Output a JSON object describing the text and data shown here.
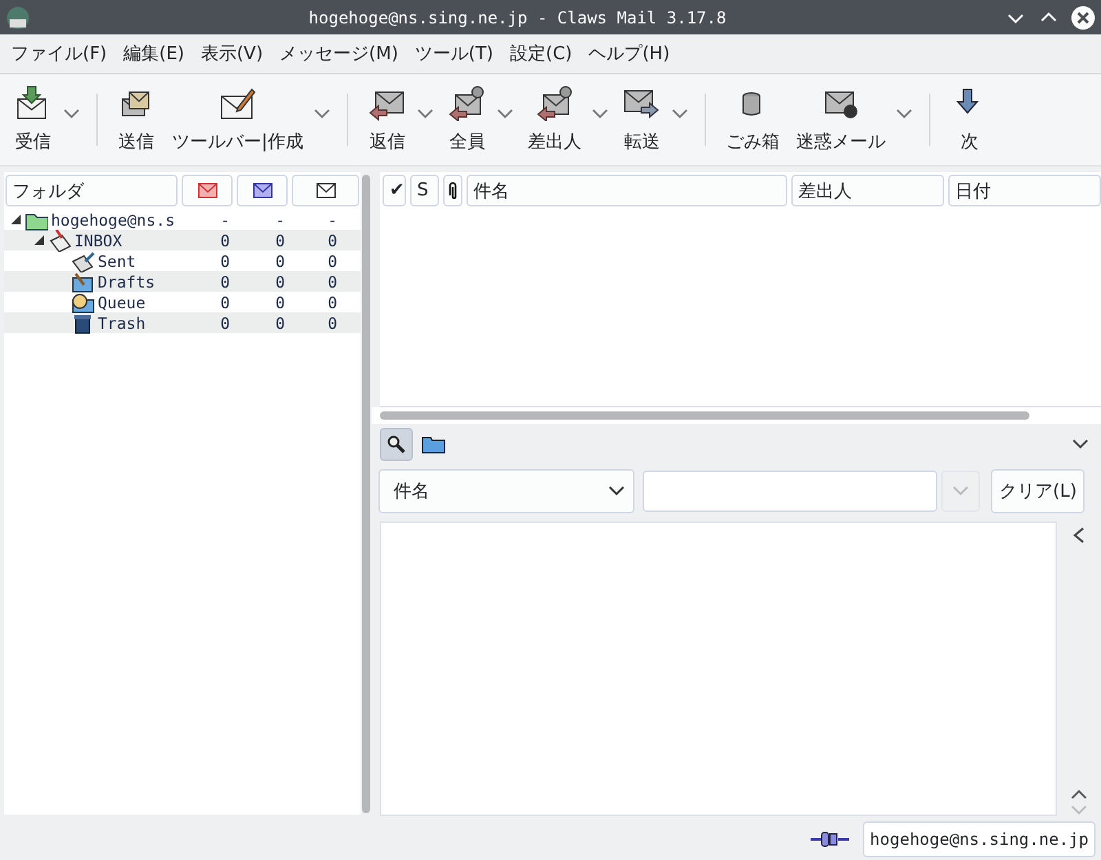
{
  "window": {
    "title": "hogehoge@ns.sing.ne.jp - Claws Mail 3.17.8"
  },
  "menu": [
    "ファイル(F)",
    "編集(E)",
    "表示(V)",
    "メッセージ(M)",
    "ツール(T)",
    "設定(C)",
    "ヘルプ(H)"
  ],
  "toolbar": [
    {
      "kind": "button",
      "label": "受信",
      "dropdown": true
    },
    {
      "kind": "separator"
    },
    {
      "kind": "button",
      "label": "送信",
      "dropdown": false
    },
    {
      "kind": "button",
      "label": "ツールバー|作成",
      "dropdown": true
    },
    {
      "kind": "separator"
    },
    {
      "kind": "button",
      "label": "返信",
      "dropdown": true
    },
    {
      "kind": "button",
      "label": "全員",
      "dropdown": true
    },
    {
      "kind": "button",
      "label": "差出人",
      "dropdown": true
    },
    {
      "kind": "button",
      "label": "転送",
      "dropdown": true
    },
    {
      "kind": "separator"
    },
    {
      "kind": "button",
      "label": "ごみ箱",
      "dropdown": false
    },
    {
      "kind": "button",
      "label": "迷惑メール",
      "dropdown": true
    },
    {
      "kind": "separator"
    },
    {
      "kind": "button",
      "label": "次",
      "dropdown": false
    }
  ],
  "folder_list": {
    "column_header": "フォルダ",
    "folders": [
      {
        "kind": "account",
        "name": "hogehoge@ns.s",
        "new": "-",
        "unread": "-",
        "total": "-",
        "expanded": true,
        "children": [
          {
            "kind": "inbox",
            "name": "INBOX",
            "new": "0",
            "unread": "0",
            "total": "0",
            "expanded": true,
            "children": [
              {
                "kind": "sent",
                "name": "Sent",
                "new": "0",
                "unread": "0",
                "total": "0"
              },
              {
                "kind": "drafts",
                "name": "Drafts",
                "new": "0",
                "unread": "0",
                "total": "0"
              },
              {
                "kind": "queue",
                "name": "Queue",
                "new": "0",
                "unread": "0",
                "total": "0"
              },
              {
                "kind": "trash",
                "name": "Trash",
                "new": "0",
                "unread": "0",
                "total": "0"
              }
            ]
          }
        ]
      }
    ]
  },
  "message_list": {
    "columns": [
      "✔",
      "S",
      "件名",
      "差出人",
      "日付"
    ]
  },
  "quick_search": {
    "search_type": "件名",
    "clear_button": "クリア(L)"
  },
  "status_bar": {
    "account": "hogehoge@ns.sing.ne.jp",
    "online": true
  }
}
